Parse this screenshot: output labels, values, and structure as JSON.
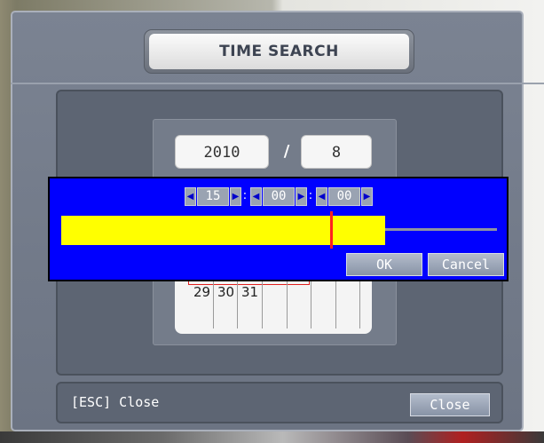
{
  "dialog": {
    "title": "TIME SEARCH",
    "date": {
      "year": "2010",
      "separator": "/",
      "month": "8"
    },
    "calendar": {
      "visible_days": [
        "29",
        "30",
        "31"
      ]
    }
  },
  "time_popup": {
    "hour": "15",
    "sep1": ":",
    "minute": "00",
    "sep2": ":",
    "second": "00",
    "spin_left_icon": "◀",
    "spin_right_icon": "▶",
    "ok_label": "OK",
    "cancel_label": "Cancel",
    "recorded_fraction": 0.73,
    "marker_fraction": 0.62,
    "colors": {
      "popup_bg": "#0000ff",
      "recorded": "#ffff00",
      "marker": "#ff2020"
    }
  },
  "footer": {
    "esc_hint": "[ESC] Close",
    "close_label": "Close"
  }
}
